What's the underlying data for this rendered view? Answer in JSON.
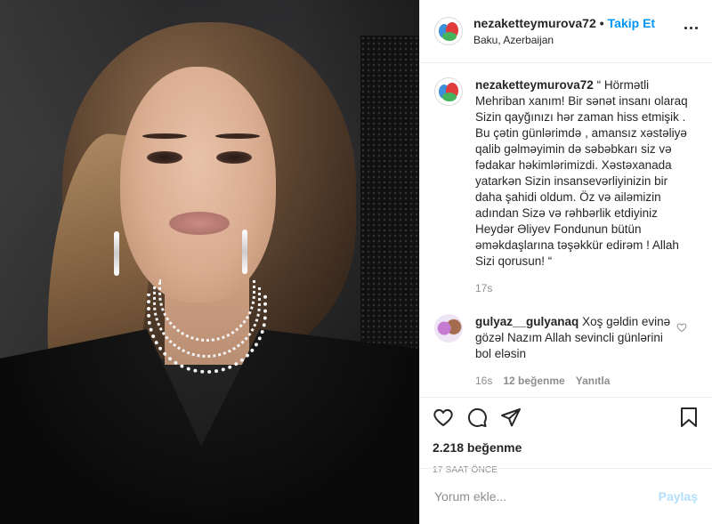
{
  "post": {
    "username": "nezaketteymurova72",
    "follow_label": "Takip Et",
    "location": "Baku, Azerbaijan",
    "caption": "“ Hörmətli Mehriban xanım! Bir sənət insanı olaraq Sizin qayğınızı hər zaman hiss etmişik . Bu çətin günlərimdə , amansız xəstəliyə qalib gəlməyimin də səbəbkarı siz və fədakar həkimlərimizdi. Xəstəxanada yatarkən Sizin insansevərliyinizin bir daha şahidi oldum. Öz və ailəmizin adından Sizə və rəhbərlik etdiyiniz Heydər Əliyev Fondunun bütün əməkdaşlarına təşəkkür edirəm ! Allah Sizi qorusun! “",
    "caption_time": "17s",
    "likes": "2.218 beğenme",
    "posted_ago": "17 SAAT ÖNCE"
  },
  "comment": {
    "username": "gulyaz__gulyanaq",
    "text": "Xoş gəldin evinə gözəl Nazım Allah sevincli günlərini bol eləsin",
    "time": "16s",
    "likes": "12 beğenme",
    "reply_label": "Yanıtla"
  },
  "add_comment": {
    "placeholder": "Yorum ekle...",
    "post_label": "Paylaş"
  },
  "icons": [
    "more-icon",
    "heart-icon",
    "comment-icon",
    "share-icon",
    "save-icon"
  ],
  "colors": {
    "link": "#0095f6",
    "muted": "#8e8e8e",
    "text": "#262626",
    "post_disabled": "#b2dffc"
  }
}
